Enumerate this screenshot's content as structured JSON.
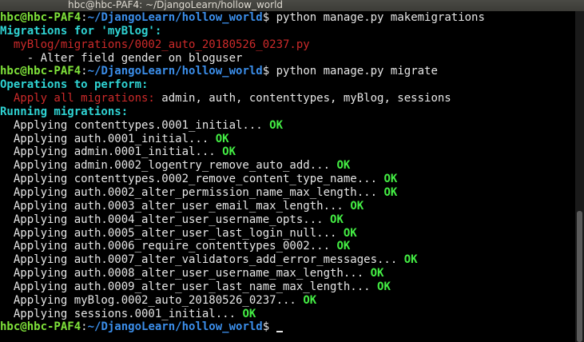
{
  "window": {
    "title": "hbc@hbc-PAF4: ~/DjangoLearn/hollow_world"
  },
  "terminal": {
    "lines": [
      {
        "type": "prompt",
        "user": "hbc@hbc-PAF4",
        "sep": ":",
        "path": "~/DjangoLearn/hollow_world",
        "dollar": "$",
        "cmd": " python manage.py makemigrations"
      },
      {
        "type": "cyan",
        "text": "Migrations for 'myBlog':"
      },
      {
        "type": "red",
        "text": "  myBlog/migrations/0002_auto_20180526_0237.py"
      },
      {
        "type": "plain",
        "text": "    - Alter field gender on bloguser"
      },
      {
        "type": "prompt",
        "user": "hbc@hbc-PAF4",
        "sep": ":",
        "path": "~/DjangoLearn/hollow_world",
        "dollar": "$",
        "cmd": " python manage.py migrate"
      },
      {
        "type": "cyan",
        "text": "Operations to perform:"
      },
      {
        "type": "redlabel",
        "label": "  Apply all migrations:",
        "text": " admin, auth, contenttypes, myBlog, sessions"
      },
      {
        "type": "cyan",
        "text": "Running migrations:"
      },
      {
        "type": "apply",
        "text": "  Applying contenttypes.0001_initial...",
        "status": "OK"
      },
      {
        "type": "apply",
        "text": "  Applying auth.0001_initial...",
        "status": "OK"
      },
      {
        "type": "apply",
        "text": "  Applying admin.0001_initial...",
        "status": "OK"
      },
      {
        "type": "apply",
        "text": "  Applying admin.0002_logentry_remove_auto_add...",
        "status": "OK"
      },
      {
        "type": "apply",
        "text": "  Applying contenttypes.0002_remove_content_type_name...",
        "status": "OK"
      },
      {
        "type": "apply",
        "text": "  Applying auth.0002_alter_permission_name_max_length...",
        "status": "OK"
      },
      {
        "type": "apply",
        "text": "  Applying auth.0003_alter_user_email_max_length...",
        "status": "OK"
      },
      {
        "type": "apply",
        "text": "  Applying auth.0004_alter_user_username_opts...",
        "status": "OK"
      },
      {
        "type": "apply",
        "text": "  Applying auth.0005_alter_user_last_login_null...",
        "status": "OK"
      },
      {
        "type": "apply",
        "text": "  Applying auth.0006_require_contenttypes_0002...",
        "status": "OK"
      },
      {
        "type": "apply",
        "text": "  Applying auth.0007_alter_validators_add_error_messages...",
        "status": "OK"
      },
      {
        "type": "apply",
        "text": "  Applying auth.0008_alter_user_username_max_length...",
        "status": "OK"
      },
      {
        "type": "apply",
        "text": "  Applying auth.0009_alter_user_last_name_max_length...",
        "status": "OK"
      },
      {
        "type": "apply",
        "text": "  Applying myBlog.0002_auto_20180526_0237...",
        "status": "OK"
      },
      {
        "type": "apply",
        "text": "  Applying sessions.0001_initial...",
        "status": "OK"
      },
      {
        "type": "prompt",
        "user": "hbc@hbc-PAF4",
        "sep": ":",
        "path": "~/DjangoLearn/hollow_world",
        "dollar": "$",
        "cmd": " ",
        "cursor": true
      }
    ]
  },
  "colors": {
    "user": "#7fe23a",
    "path": "#3b8eea",
    "heading": "#2fd3d3",
    "error": "#cc2a2a",
    "ok": "#44ee44",
    "background": "#000000"
  }
}
